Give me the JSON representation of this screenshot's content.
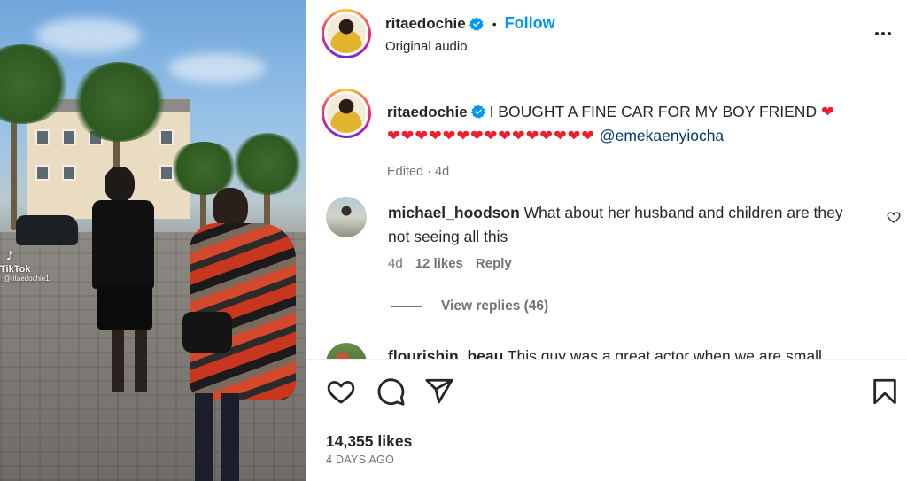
{
  "media": {
    "watermark_brand": "TikTok",
    "watermark_handle": "@ritaedochie1"
  },
  "header": {
    "username": "ritaedochie",
    "separator": "•",
    "follow_label": "Follow",
    "audio_label": "Original audio",
    "more_icon": "more-horizontal-icon"
  },
  "caption": {
    "username": "ritaedochie",
    "text": "I BOUGHT A FINE CAR FOR MY BOY FRIEND",
    "hearts_first": "❤",
    "hearts_row": "❤❤❤❤❤❤❤❤❤❤❤❤❤❤❤",
    "mention": "@emekaenyiocha",
    "edited": "Edited · 4d"
  },
  "comments": [
    {
      "username": "michael_hoodson",
      "text": "What about her husband and children are they not seeing all this",
      "age": "4d",
      "likes": "12 likes",
      "reply_label": "Reply",
      "view_replies": "View replies (46)"
    },
    {
      "username": "flourishin_beau",
      "text": "This guy was a great actor when we are small"
    }
  ],
  "actions": {
    "likes": "14,355 likes",
    "time_ago": "4 DAYS AGO"
  },
  "colors": {
    "accent": "#0095f6",
    "heart": "#ef1d2e",
    "mention": "#00376b",
    "muted": "#737373",
    "verified": "#0095f6"
  }
}
